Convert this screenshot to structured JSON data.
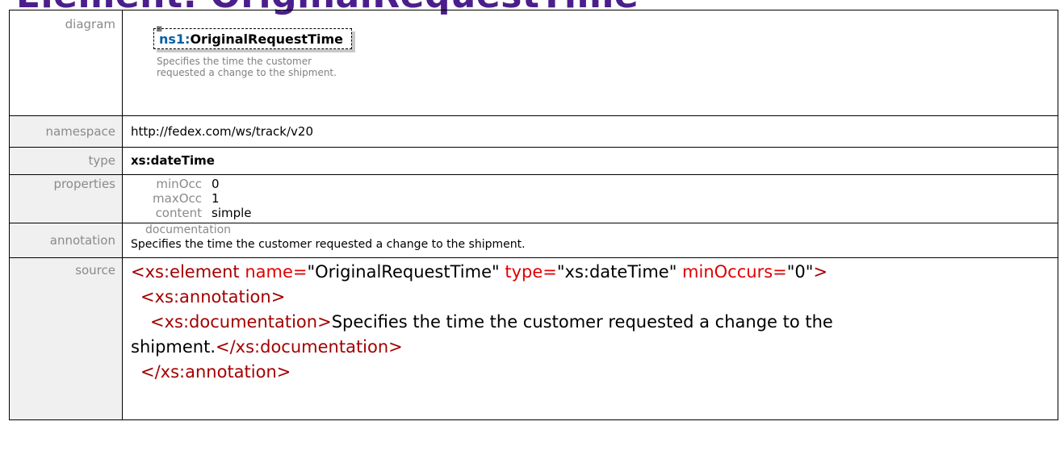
{
  "heading": "Element: OriginalRequestTime",
  "labels": {
    "diagram": "diagram",
    "namespace": "namespace",
    "type": "type",
    "properties": "properties",
    "annotation": "annotation",
    "source": "source"
  },
  "diagram": {
    "prefix": "ns1:",
    "name": "OriginalRequestTime",
    "doc": "Specifies the time the customer requested a change to the shipment."
  },
  "namespace": "http://fedex.com/ws/track/v20",
  "type": "xs:dateTime",
  "properties": [
    {
      "label": "minOcc",
      "value": "0"
    },
    {
      "label": "maxOcc",
      "value": "1"
    },
    {
      "label": "content",
      "value": "simple"
    }
  ],
  "annotation": {
    "header": "documentation",
    "text": "Specifies the time the customer requested a change to the shipment."
  },
  "source": {
    "line1_open": "<xs:element ",
    "attr_name": "name=",
    "val_name": "\"OriginalRequestTime\"",
    "attr_type": " type=",
    "val_type": "\"xs:dateTime\"",
    "attr_min": " minOccurs=",
    "val_min": "\"0\"",
    "close": ">",
    "line2": "<xs:annotation>",
    "line3_open": "<xs:documentation>",
    "line3_text": "Specifies the time the customer requested a change to the",
    "line4_text": "shipment.",
    "line4_close": "</xs:documentation>",
    "line5": "</xs:annotation>"
  }
}
